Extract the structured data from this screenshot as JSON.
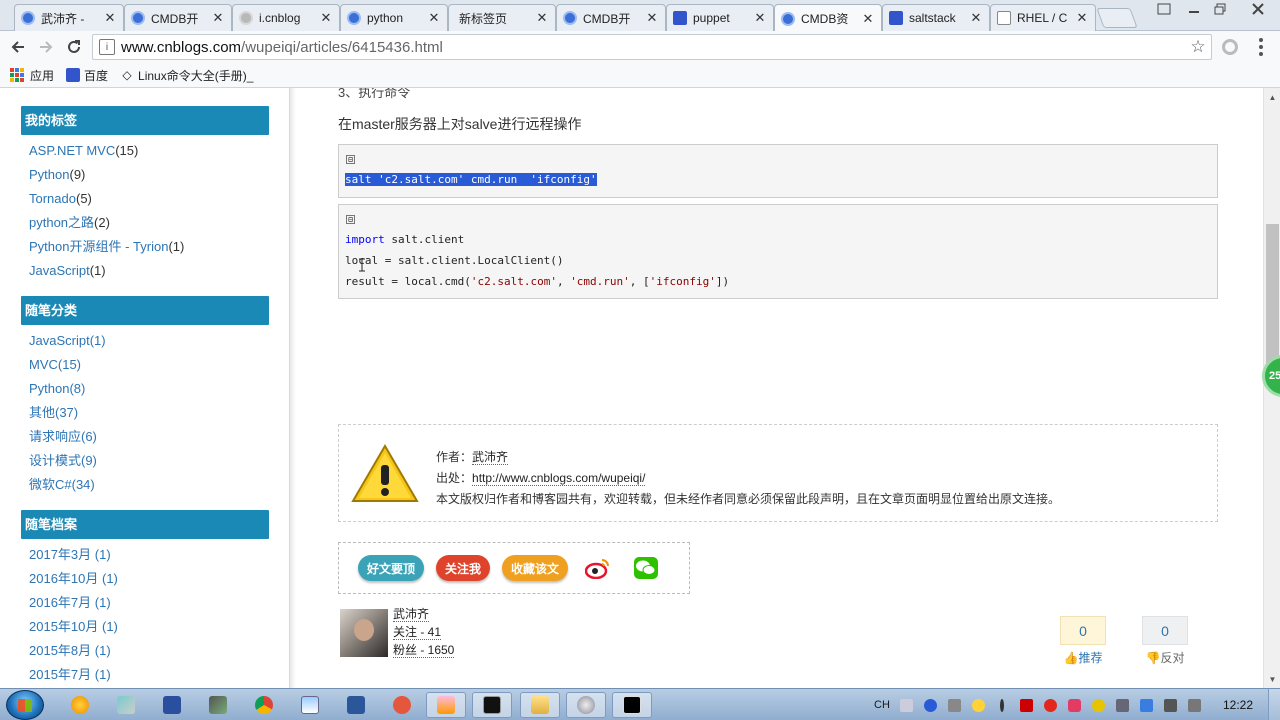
{
  "browser": {
    "tabs": [
      {
        "label": "武沛齐 -",
        "icon": "cnblogs-icon",
        "active": false
      },
      {
        "label": "CMDB开",
        "icon": "cnblogs-icon",
        "active": false
      },
      {
        "label": "i.cnblog",
        "icon": "cnblogs-gray-icon",
        "active": false
      },
      {
        "label": "python",
        "icon": "cnblogs-icon",
        "active": false
      },
      {
        "label": "新标签页",
        "icon": "",
        "active": false
      },
      {
        "label": "CMDB开",
        "icon": "cnblogs-icon",
        "active": false
      },
      {
        "label": "puppet",
        "icon": "baidu-paw-icon",
        "active": false
      },
      {
        "label": "CMDB资",
        "icon": "cnblogs-icon",
        "active": true
      },
      {
        "label": "saltstack",
        "icon": "baidu-paw-icon",
        "active": false
      },
      {
        "label": "RHEL / C",
        "icon": "box-icon",
        "active": false
      }
    ],
    "tab_close_glyph": "✕",
    "address": {
      "host": "www.cnblogs.com",
      "path": "/wupeiqi/articles/6415436.html"
    },
    "bookmarks": [
      {
        "label": "应用",
        "icon": "apps-grid-icon"
      },
      {
        "label": "百度",
        "icon": "baidu-paw-icon"
      },
      {
        "label": "Linux命令大全(手册)_",
        "icon": "diamond-icon"
      }
    ]
  },
  "sidebar": {
    "tags": {
      "title": "我的标签",
      "items": [
        {
          "label": "ASP.NET MVC",
          "count": "(15)"
        },
        {
          "label": "Python",
          "count": "(9)"
        },
        {
          "label": "Tornado",
          "count": "(5)"
        },
        {
          "label": "python之路",
          "count": "(2)"
        },
        {
          "label": "Python开源组件 - Tyrion",
          "count": "(1)"
        },
        {
          "label": "JavaScript",
          "count": "(1)"
        }
      ]
    },
    "categories": {
      "title": "随笔分类",
      "items": [
        {
          "label": "JavaScript(1)"
        },
        {
          "label": "MVC(15)"
        },
        {
          "label": "Python(8)"
        },
        {
          "label": "其他(37)"
        },
        {
          "label": "请求响应(6)"
        },
        {
          "label": "设计模式(9)"
        },
        {
          "label": "微软C#(34)"
        }
      ]
    },
    "archives": {
      "title": "随笔档案",
      "items": [
        {
          "label": "2017年3月 (1)"
        },
        {
          "label": "2016年10月 (1)"
        },
        {
          "label": "2016年7月 (1)"
        },
        {
          "label": "2015年10月 (1)"
        },
        {
          "label": "2015年8月 (1)"
        },
        {
          "label": "2015年7月 (1)"
        }
      ]
    }
  },
  "article": {
    "partial_heading": "3、执行命令",
    "paragraph": "在master服务器上对salve进行远程操作",
    "code1": {
      "toggle": "⊟",
      "line": "salt 'c2.salt.com' cmd.run  'ifconfig'"
    },
    "code2": {
      "toggle": "⊟",
      "line1_kw": "import",
      "line1_rest": " salt.client",
      "line2": "local = salt.client.LocalClient()",
      "line3_a": "result = local.cmd(",
      "line3_s1": "'c2.salt.com'",
      "line3_b": ", ",
      "line3_s2": "'cmd.run'",
      "line3_c": ", [",
      "line3_s3": "'ifconfig'",
      "line3_d": "])"
    },
    "author_box": {
      "author_label": "作者：",
      "author_name": "武沛齐",
      "source_label": "出处：",
      "source_url": "http://www.cnblogs.com/wupeiqi/",
      "copyright": "本文版权归作者和博客园共有，欢迎转载，但未经作者同意必须保留此段声明，且在文章页面明显位置给出原文连接。"
    },
    "share": {
      "good_article": "好文要顶",
      "follow": "关注我",
      "favorite": "收藏该文"
    },
    "profile": {
      "name": "武沛齐",
      "following": "关注 - 41",
      "fans": "粉丝 - 1650"
    },
    "votes": {
      "digg_count": "0",
      "digg_label": "推荐",
      "bury_count": "0",
      "bury_label": "反对"
    }
  },
  "floating_badge": "25",
  "taskbar": {
    "apps": [
      "pinwheel",
      "tool",
      "save",
      "paint",
      "chrome",
      "notepad",
      "word",
      "fish",
      "person",
      "cmd",
      "folder",
      "disk",
      "pycharm"
    ],
    "tray_lang": "CH",
    "clock": "12:22"
  },
  "colors": {
    "sidebar_head": "#1a89b6",
    "link": "#2d75b4",
    "highlight": "#2a5bd7",
    "btn_good": "#3aa3b8",
    "btn_follow": "#e0432b",
    "btn_fav": "#f0a020"
  }
}
